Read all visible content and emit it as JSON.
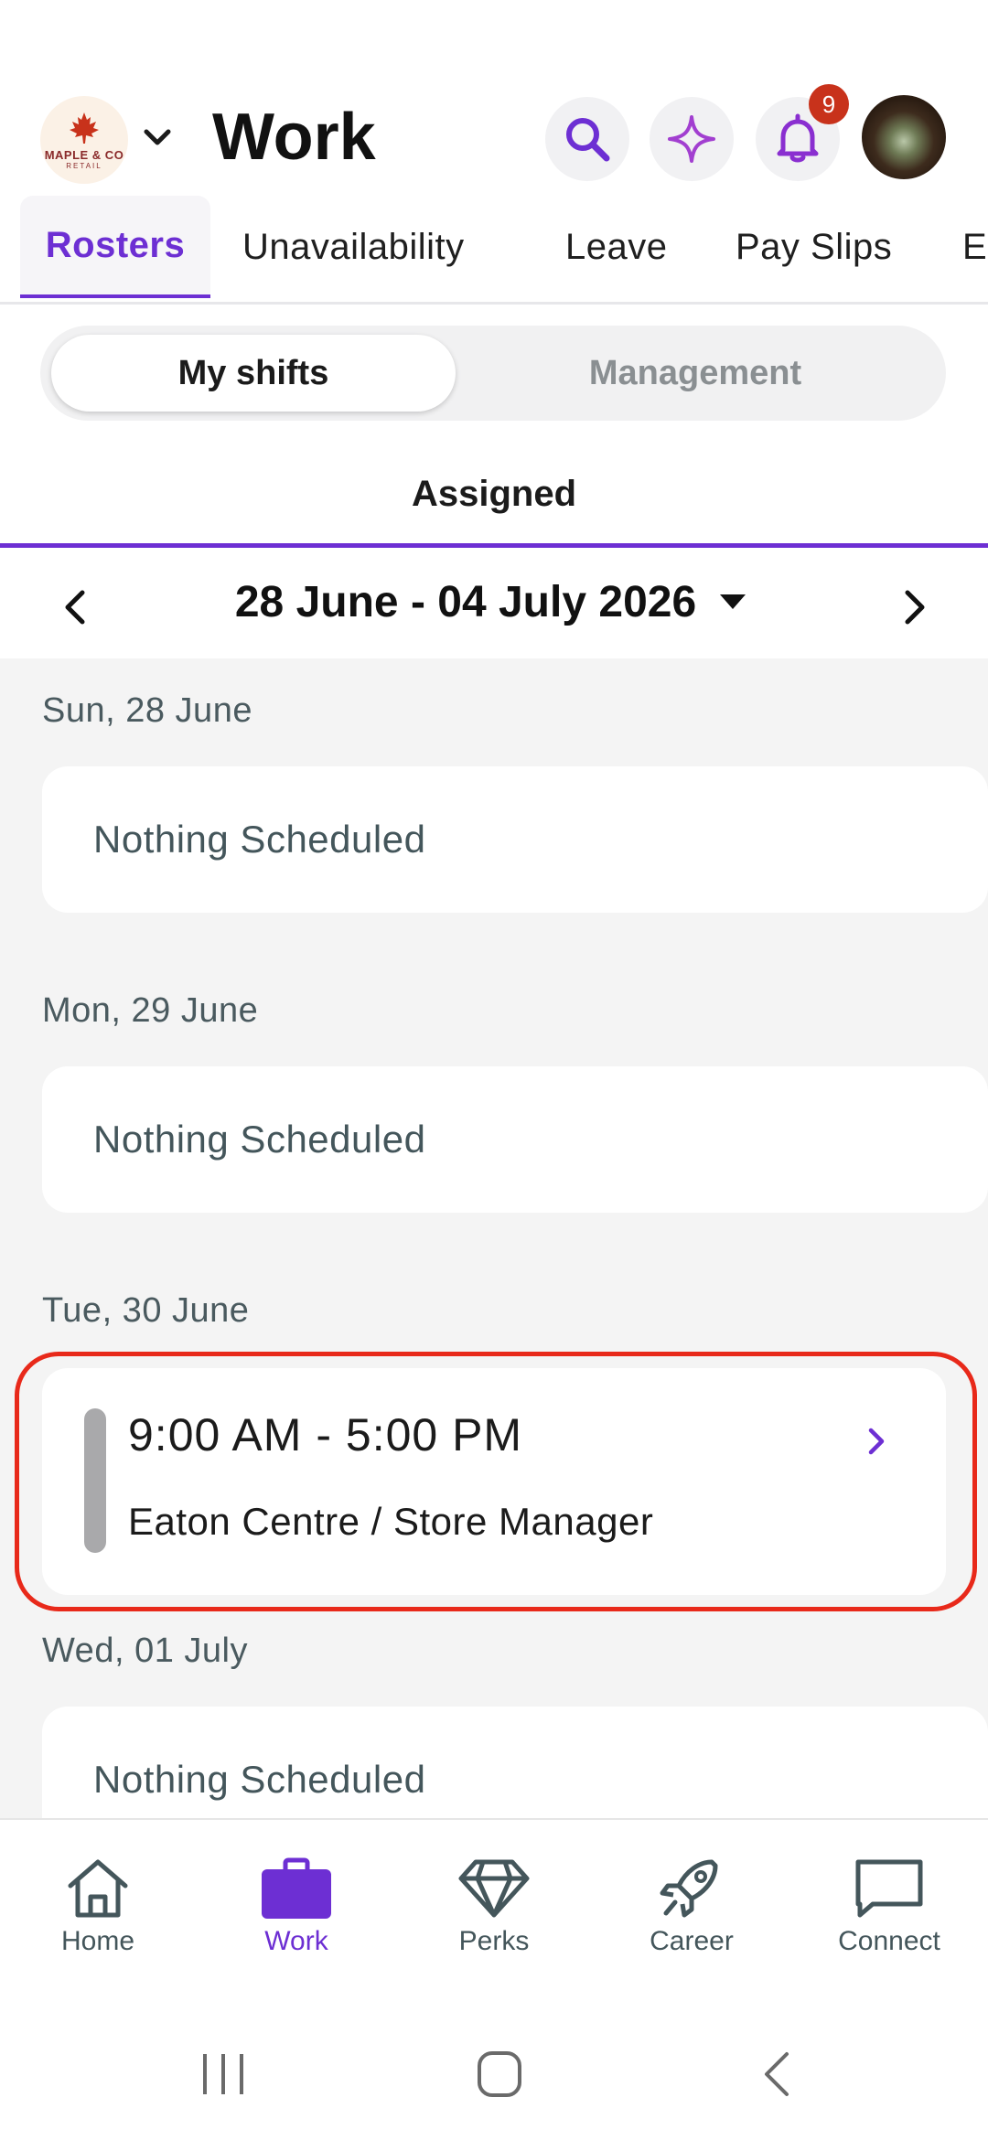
{
  "header": {
    "org_logo_text": "MAPLE & CO",
    "org_logo_subtext": "RETAIL",
    "title": "Work",
    "notification_count": "9"
  },
  "tabs": [
    {
      "label": "Rosters",
      "active": true
    },
    {
      "label": "Unavailability"
    },
    {
      "label": "Leave"
    },
    {
      "label": "Pay Slips"
    },
    {
      "label": "E"
    }
  ],
  "segmented": {
    "my_shifts": "My shifts",
    "management": "Management"
  },
  "sub_tab": "Assigned",
  "week": {
    "range": "28 June - 04 July 2026"
  },
  "days": [
    {
      "label": "Sun, 28 June",
      "status": "Nothing Scheduled"
    },
    {
      "label": "Mon, 29 June",
      "status": "Nothing Scheduled"
    },
    {
      "label": "Tue, 30 June",
      "shift": {
        "time": "9:00 AM - 5:00 PM",
        "location": "Eaton Centre / Store Manager"
      }
    },
    {
      "label": "Wed, 01 July",
      "status": "Nothing Scheduled"
    }
  ],
  "bottom_nav": [
    {
      "label": "Home",
      "icon": "home-icon"
    },
    {
      "label": "Work",
      "icon": "briefcase-icon",
      "active": true
    },
    {
      "label": "Perks",
      "icon": "diamond-icon"
    },
    {
      "label": "Career",
      "icon": "rocket-icon"
    },
    {
      "label": "Connect",
      "icon": "chat-icon"
    }
  ],
  "colors": {
    "accent": "#6d2fd3",
    "badge": "#c8321b",
    "highlight": "#e8291a"
  }
}
